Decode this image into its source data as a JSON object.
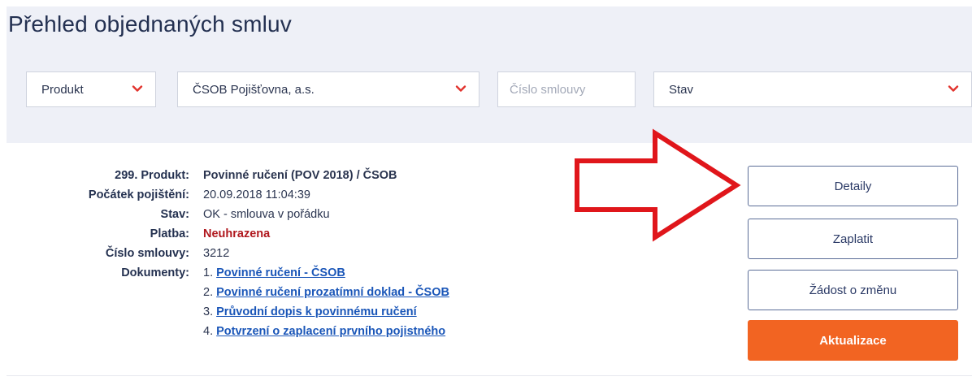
{
  "page": {
    "title": "Přehled objednaných smluv"
  },
  "filters": {
    "produkt": {
      "label": "Produkt",
      "icon": "chevron-down-icon"
    },
    "pojistovna": {
      "label": "ČSOB Pojišťovna, a.s.",
      "icon": "chevron-down-icon"
    },
    "cislo_smlouvy": {
      "placeholder": "Číslo smlouvy"
    },
    "stav": {
      "label": "Stav",
      "icon": "chevron-down-icon"
    },
    "chevron_color": "#e2332d"
  },
  "contract": {
    "produkt_label": "299. Produkt:",
    "produkt_value": "Povinné ručení (POV 2018) / ČSOB",
    "pocatek_label": "Počátek pojištění:",
    "pocatek_value": "20.09.2018 11:04:39",
    "stav_label": "Stav:",
    "stav_value": "OK - smlouva v pořádku",
    "platba_label": "Platba:",
    "platba_value": "Neuhrazena",
    "cislo_label": "Číslo smlouvy:",
    "cislo_value": "3212",
    "dokumenty_label": "Dokumenty:",
    "documents": [
      {
        "num": "1.",
        "title": "Povinné ručení - ČSOB"
      },
      {
        "num": "2.",
        "title": "Povinné ručení prozatímní doklad - ČSOB"
      },
      {
        "num": "3.",
        "title": "Průvodní dopis k povinnému ručení"
      },
      {
        "num": "4.",
        "title": "Potvrzení o zaplacení prvního pojistného"
      }
    ]
  },
  "actions": {
    "detaily": "Detaily",
    "zaplatit": "Zaplatit",
    "zadost": "Žádost o změnu",
    "aktualizace": "Aktualizace"
  },
  "colors": {
    "accent": "#f26422",
    "status_unpaid": "#b0181e",
    "link": "#1a56b8",
    "annotation_arrow": "#e0161b"
  }
}
